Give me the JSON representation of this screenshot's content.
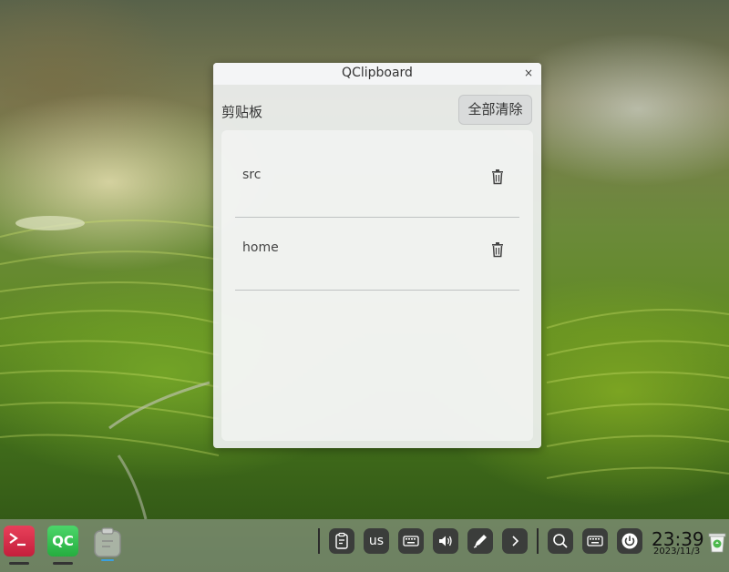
{
  "window": {
    "title": "QClipboard",
    "close_glyph": "×"
  },
  "header": {
    "section_title": "剪贴板",
    "clear_all_label": "全部清除"
  },
  "clipboard_items": [
    {
      "text": "src",
      "delete_icon": "trash-icon"
    },
    {
      "text": "home",
      "delete_icon": "trash-icon"
    }
  ],
  "taskbar": {
    "apps": [
      {
        "name": "terminal",
        "glyph": ">_",
        "color": "#d8304c"
      },
      {
        "name": "qclipboard",
        "label": "QC",
        "color": "#35c152"
      },
      {
        "name": "clipboard",
        "icon": "clipboard-icon"
      }
    ],
    "tray": {
      "clipboard_icon": "clipboard-icon",
      "keyboard_layout": "us",
      "virtual_keyboard_icon": "keyboard-icon",
      "volume_icon": "volume-icon",
      "pen_icon": "pen-icon",
      "expand_icon": "chevron-right-icon",
      "search_icon": "search-icon",
      "keyboard_icon": "keyboard-icon",
      "power_icon": "power-icon"
    },
    "clock": {
      "time": "23:39",
      "date": "2023/11/3"
    },
    "trash_icon": "trash-bin-icon"
  }
}
